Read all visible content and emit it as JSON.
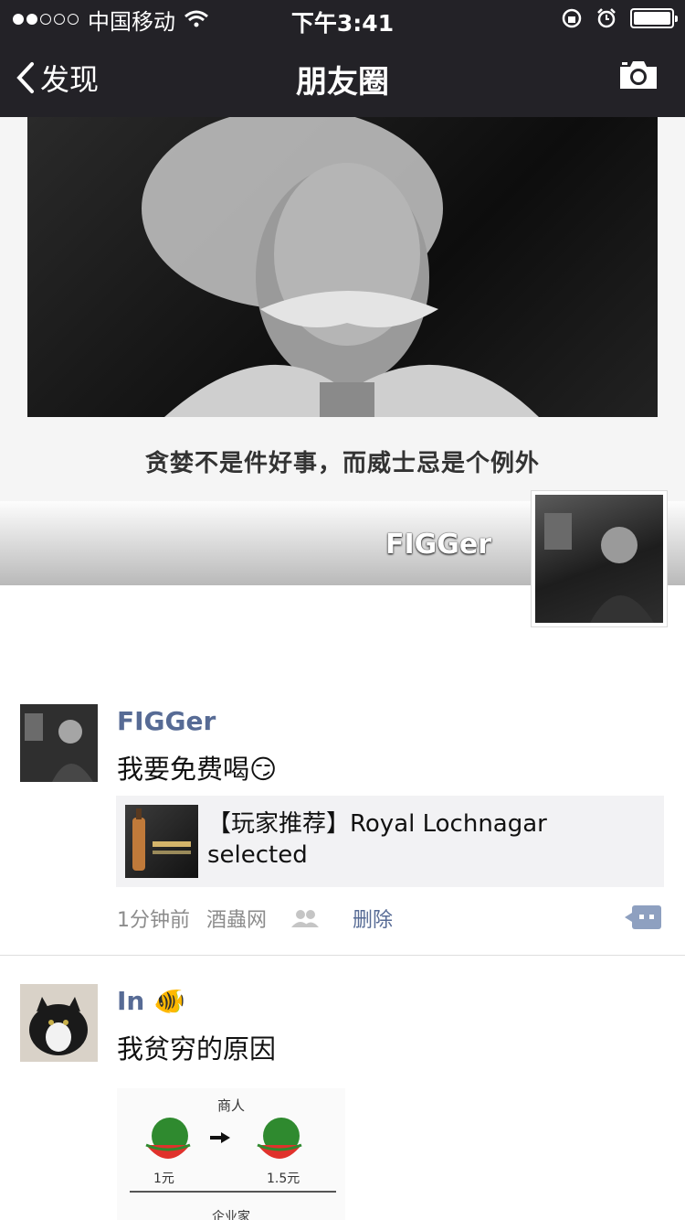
{
  "status": {
    "carrier": "中国移动",
    "time": "下午3:41"
  },
  "nav": {
    "back_label": "发现",
    "title": "朋友圈"
  },
  "cover": {
    "caption": "贪婪不是件好事，而威士忌是个例外",
    "user_name": "FIGGer"
  },
  "posts": [
    {
      "name": "FIGGer",
      "text": "我要免费喝",
      "emoji": "😏",
      "share_title": "【玩家推荐】Royal Lochnagar selected",
      "time": "1分钟前",
      "source": "酒蟲网",
      "delete_label": "删除"
    },
    {
      "name": "In",
      "emoji": "🐠",
      "text": "我贫穷的原因",
      "image": {
        "header": "商人",
        "price_left": "1元",
        "price_right": "1.5元",
        "footer": "企业家"
      }
    }
  ],
  "colors": {
    "nav_bg": "#232227",
    "link": "#576b95",
    "share_bg": "#f2f2f4"
  }
}
